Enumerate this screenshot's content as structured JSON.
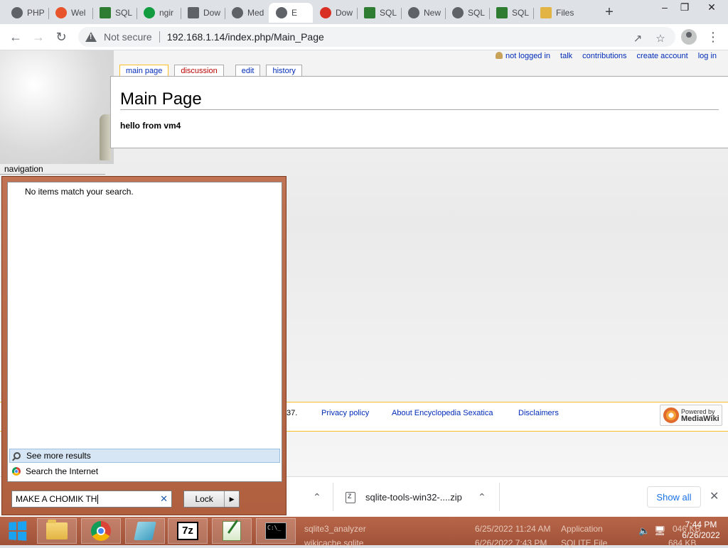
{
  "browser": {
    "tabs": [
      {
        "label": "PHP",
        "icon": "globe-icon",
        "color": "#5f6368"
      },
      {
        "label": "Wel",
        "icon": "brave-icon",
        "color": "#e8542c"
      },
      {
        "label": "SQL",
        "icon": "sqlite-icon",
        "color": "#2e7d32"
      },
      {
        "label": "ngir",
        "icon": "nginx-icon",
        "color": "#119c3f"
      },
      {
        "label": "Dow",
        "icon": "download-icon",
        "color": "#5f6368"
      },
      {
        "label": "Med",
        "icon": "globe-icon",
        "color": "#5f6368"
      },
      {
        "label": "E",
        "icon": "globe-icon",
        "color": "#5f6368",
        "active": true
      },
      {
        "label": "Dow",
        "icon": "store-icon",
        "color": "#d93025"
      },
      {
        "label": "SQL",
        "icon": "sqlite-icon",
        "color": "#2e7d32"
      },
      {
        "label": "New",
        "icon": "chrome-icon",
        "color": "#5f6368"
      },
      {
        "label": "SQL",
        "icon": "diamond-icon",
        "color": "#5f6368"
      },
      {
        "label": "SQL",
        "icon": "sqlite-icon",
        "color": "#2e7d32"
      },
      {
        "label": "Files",
        "icon": "folder-icon",
        "color": "#e2b443"
      }
    ],
    "new_tab": "+",
    "window_controls": {
      "minimize": "–",
      "restore": "❐",
      "close": "✕"
    },
    "security_label": "Not secure",
    "url": "192.168.1.14/index.php/Main_Page"
  },
  "wiki": {
    "personal_links": [
      "not logged in",
      "talk",
      "contributions",
      "create account",
      "log in"
    ],
    "tabs": [
      {
        "label": "main page",
        "selected": true
      },
      {
        "label": "discussion",
        "red": true
      },
      {
        "label": "edit"
      },
      {
        "label": "history"
      }
    ],
    "title": "Main Page",
    "body": "hello from vm4",
    "nav_label": "navigation",
    "footer": {
      "fragment": "37.",
      "links": [
        "Privacy policy",
        "About Encyclopedia Sexatica",
        "Disclaimers"
      ],
      "badge_line1": "Powered by",
      "badge_line2": "MediaWiki"
    }
  },
  "downloads": {
    "file_name": "sqlite-tools-win32-....zip",
    "show_all": "Show all",
    "close": "✕"
  },
  "start_menu": {
    "no_results": "No items match your search.",
    "see_more": "See more results",
    "search_internet": "Search the Internet",
    "search_value": "MAKE A CHOMIK TH",
    "clear": "✕",
    "lock_label": "Lock",
    "lock_arrow": "▶"
  },
  "taskbar": {
    "apps": [
      "start-orb",
      "file-explorer",
      "chrome",
      "notepad",
      "7zip",
      "notepad-plus",
      "cmd"
    ],
    "behind_rows": [
      {
        "name": "sqlite3_analyzer",
        "date": "6/25/2022 11:24 AM",
        "type": "Application",
        "size": "046 KB"
      },
      {
        "name": "wikicache.sqlite",
        "date": "6/26/2022 7:43 PM",
        "type": "SQLITE File",
        "size": "684 KB"
      }
    ],
    "time": "7:44 PM",
    "date": "6/26/2022"
  }
}
